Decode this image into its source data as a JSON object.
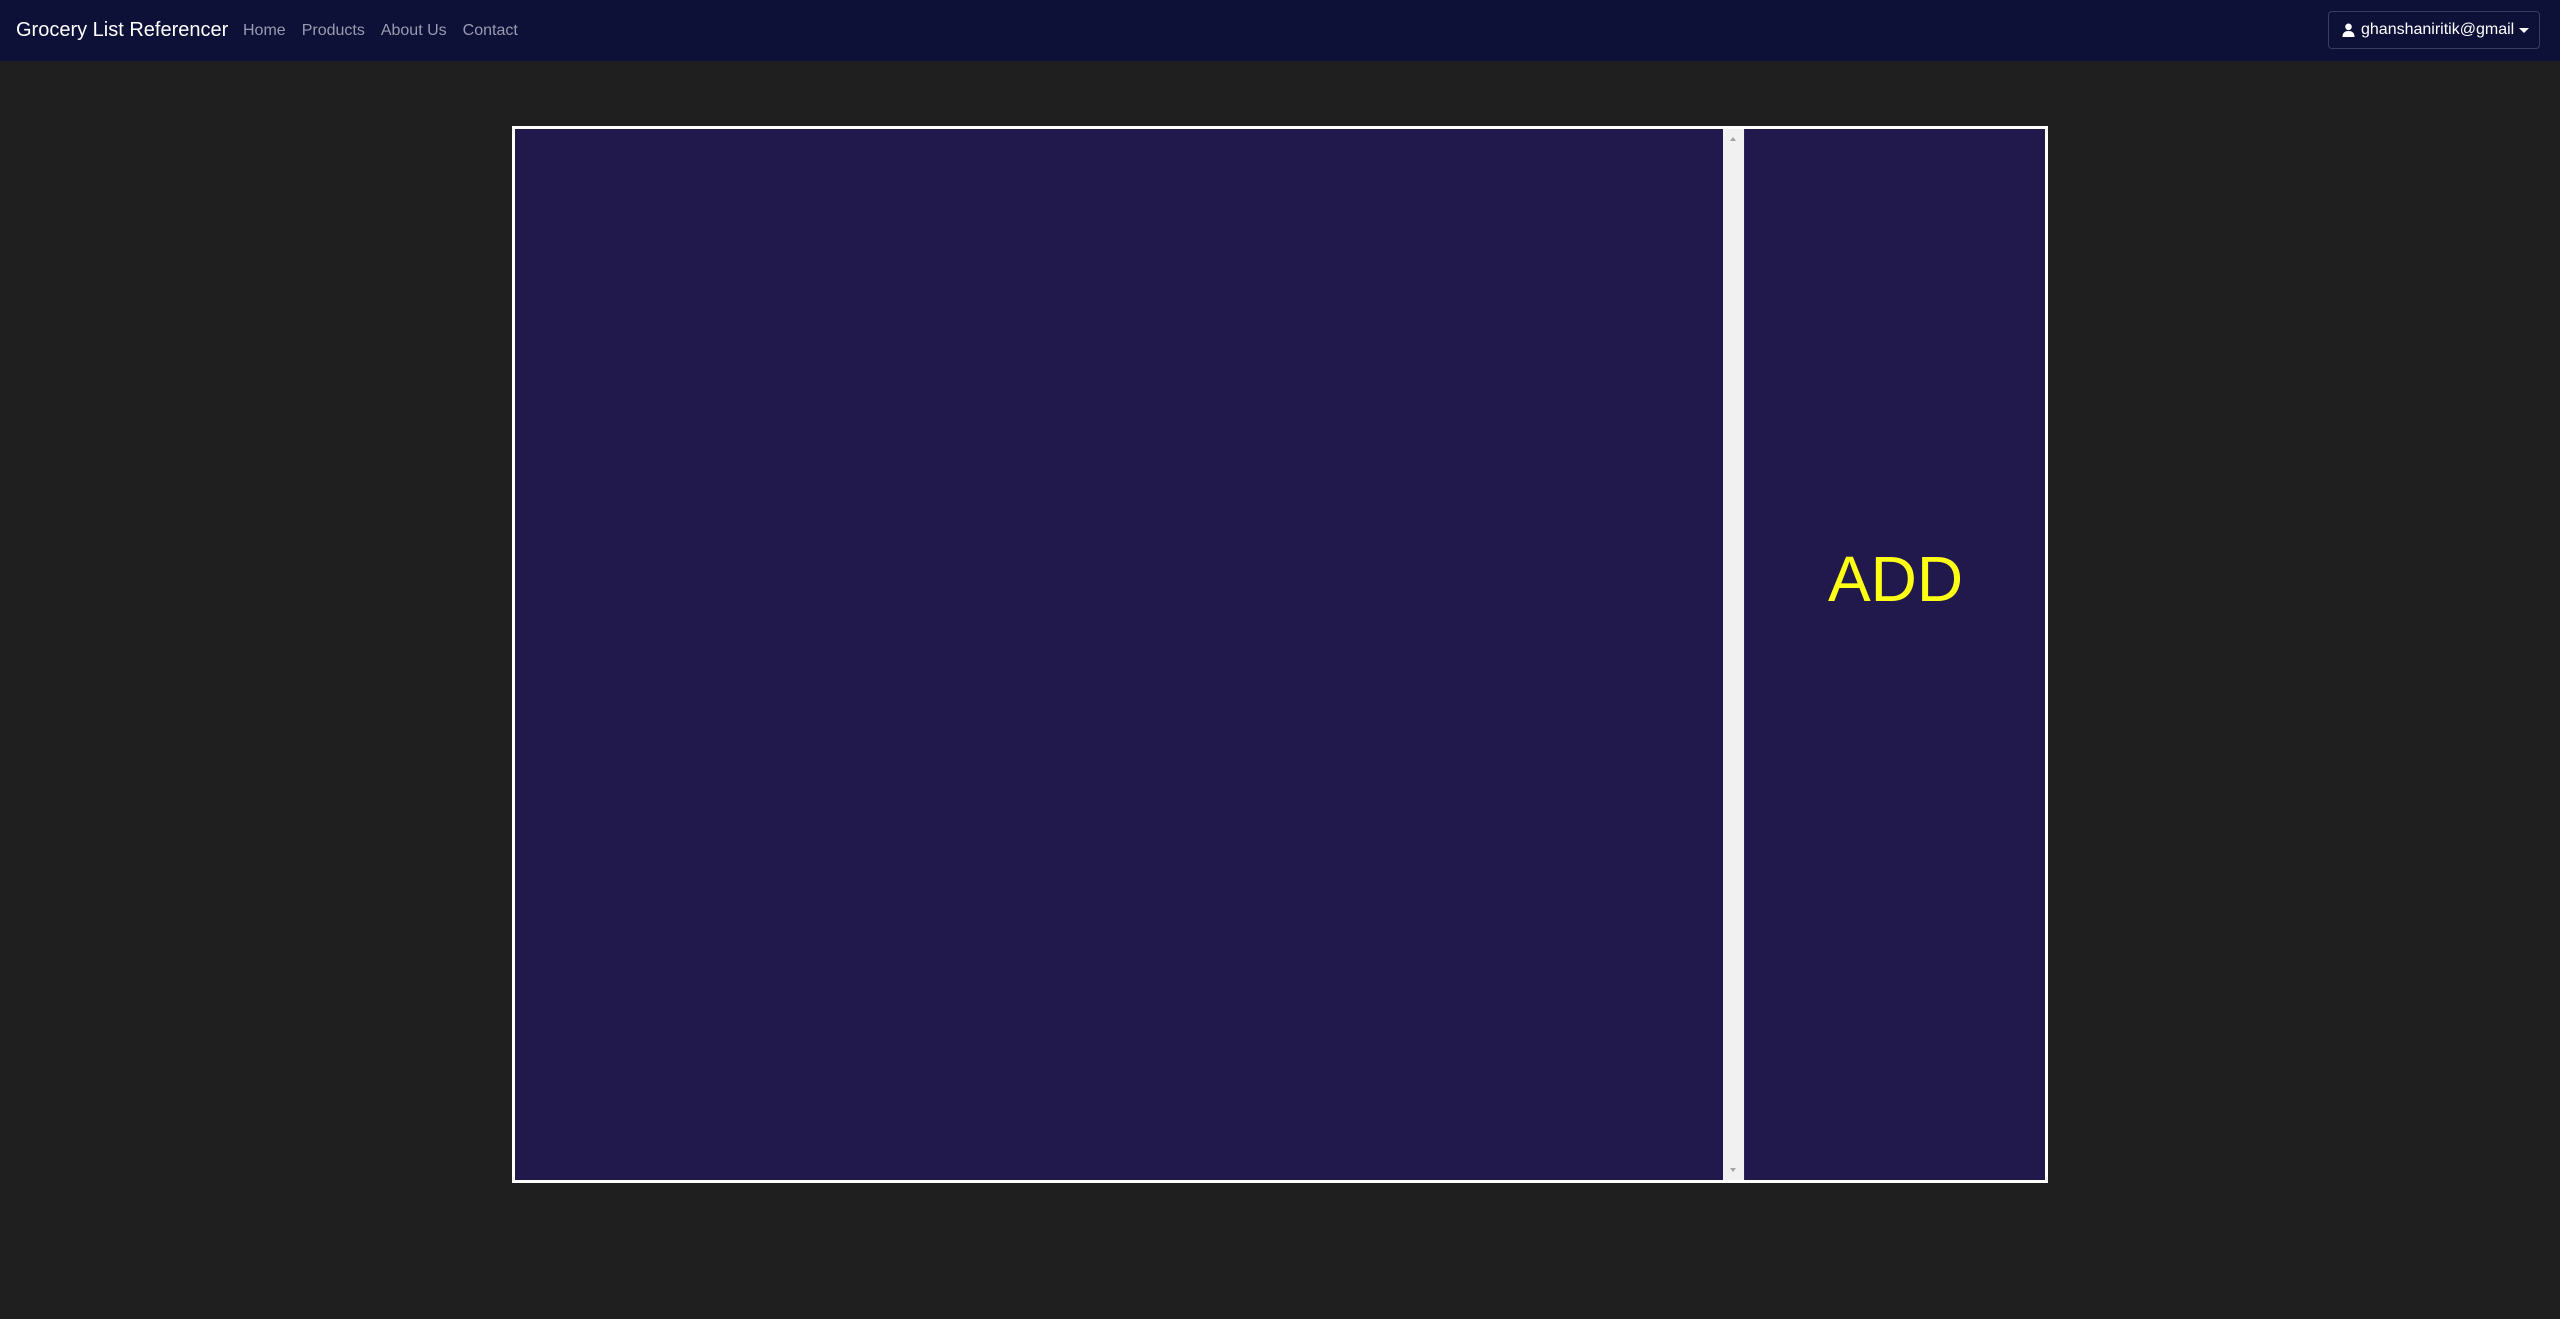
{
  "navbar": {
    "brand": "Grocery List Referencer",
    "links": [
      "Home",
      "Products",
      "About Us",
      "Contact"
    ],
    "user": {
      "icon": "user-icon",
      "label": "ghanshaniritik@gmail"
    }
  },
  "main": {
    "add_label": "ADD"
  },
  "colors": {
    "navbar_bg": "#0d1137",
    "page_bg": "#1f1f1f",
    "panel_bg": "#21184b",
    "add_text": "#ffff16",
    "panel_border": "#ffffff"
  }
}
